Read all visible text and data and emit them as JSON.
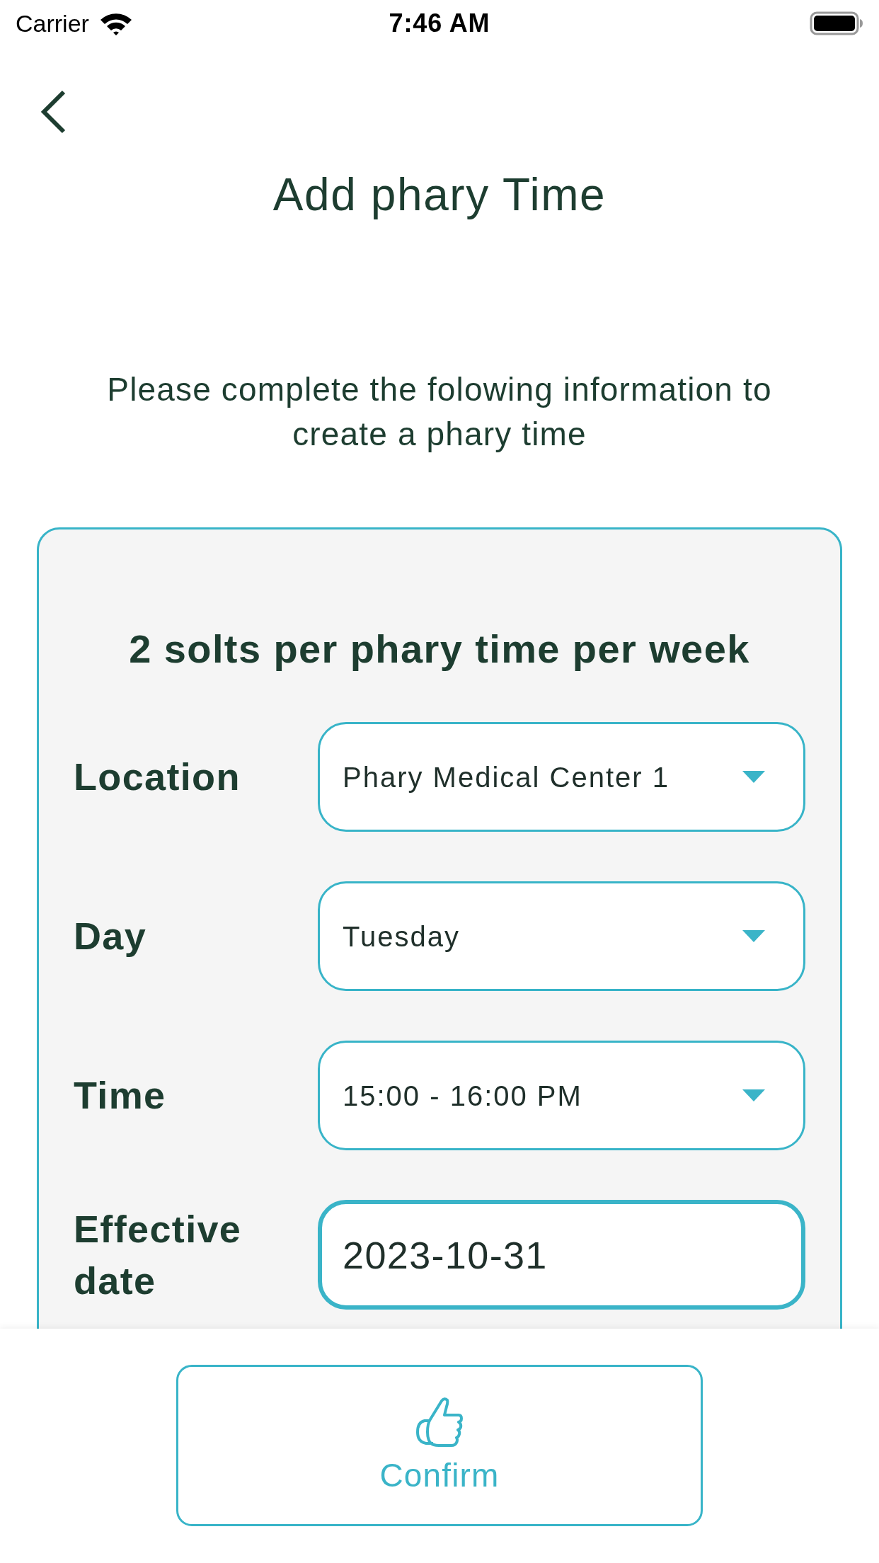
{
  "status_bar": {
    "carrier": "Carrier",
    "time": "7:46 AM"
  },
  "header": {
    "title": "Add phary Time"
  },
  "intro": "Please complete the folowing information to create a phary time",
  "form": {
    "heading": "2 solts per phary time per week",
    "fields": [
      {
        "kind": "dropdown",
        "label": "Location",
        "value": "Phary Medical Center 1",
        "focused": false
      },
      {
        "kind": "dropdown",
        "label": "Day",
        "value": "Tuesday",
        "focused": false
      },
      {
        "kind": "dropdown",
        "label": "Time",
        "value": "15:00 - 16:00 PM",
        "focused": false
      },
      {
        "kind": "text",
        "label": "Effective date",
        "value": "2023-10-31",
        "focused": true
      }
    ]
  },
  "confirm_button": {
    "label": "Confirm"
  }
}
